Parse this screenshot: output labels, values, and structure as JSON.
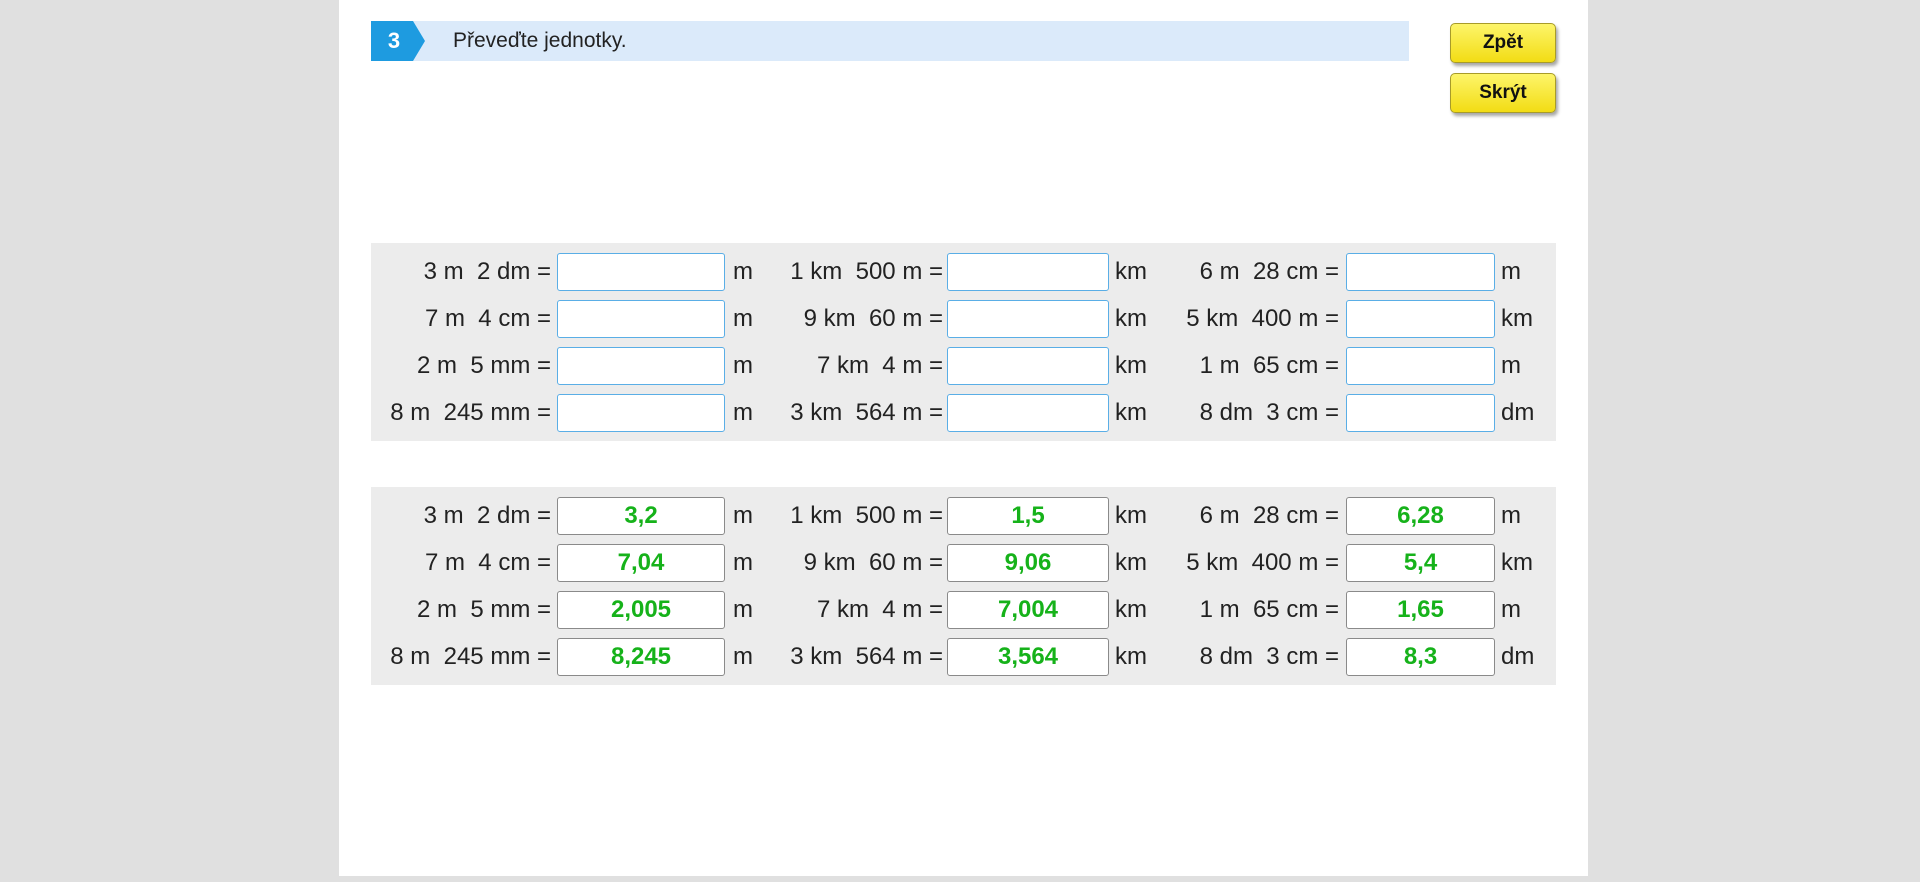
{
  "task": {
    "number": "3",
    "instruction": "Převeďte jednotky."
  },
  "buttons": {
    "back": "Zpět",
    "hide": "Skrýt"
  },
  "exercise": {
    "columns": [
      {
        "rows": [
          {
            "expr": "3 m  2 dm =",
            "unit": "m",
            "answer": "3,2"
          },
          {
            "expr": "7 m  4 cm =",
            "unit": "m",
            "answer": "7,04"
          },
          {
            "expr": "2 m  5 mm =",
            "unit": "m",
            "answer": "2,005"
          },
          {
            "expr": "8 m  245 mm =",
            "unit": "m",
            "answer": "8,245"
          }
        ]
      },
      {
        "rows": [
          {
            "expr": "1 km  500 m =",
            "unit": "km",
            "answer": "1,5"
          },
          {
            "expr": "9 km  60 m =",
            "unit": "km",
            "answer": "9,06"
          },
          {
            "expr": "7 km  4 m =",
            "unit": "km",
            "answer": "7,004"
          },
          {
            "expr": "3 km  564 m =",
            "unit": "km",
            "answer": "3,564"
          }
        ]
      },
      {
        "rows": [
          {
            "expr": "6 m  28 cm =",
            "unit": "m",
            "answer": "6,28"
          },
          {
            "expr": "5 km  400 m =",
            "unit": "km",
            "answer": "5,4"
          },
          {
            "expr": "1 m  65 cm =",
            "unit": "m",
            "answer": "1,65"
          },
          {
            "expr": "8 dm  3 cm =",
            "unit": "dm",
            "answer": "8,3"
          }
        ]
      }
    ]
  },
  "colors": {
    "accent": "#1e9be0",
    "header_bg": "#dbeafa",
    "answer_text": "#16b21a",
    "button_yellow": "#f7e62e"
  }
}
